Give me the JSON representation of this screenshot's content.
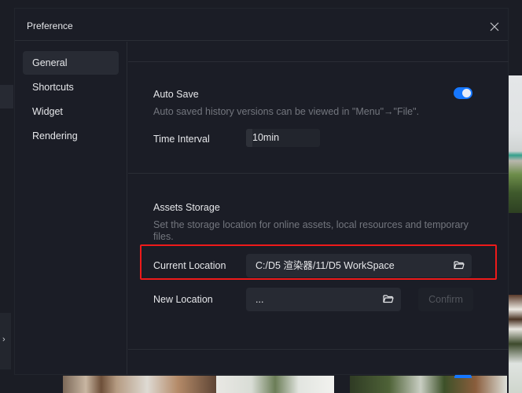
{
  "dialog": {
    "title": "Preference",
    "close_icon": "close-icon"
  },
  "sidebar": {
    "items": [
      {
        "label": "General",
        "active": true
      },
      {
        "label": "Shortcuts",
        "active": false
      },
      {
        "label": "Widget",
        "active": false
      },
      {
        "label": "Rendering",
        "active": false
      }
    ]
  },
  "auto_save": {
    "title": "Auto Save",
    "description": "Auto saved history versions can be viewed in \"Menu\"→\"File\".",
    "enabled": true,
    "time_interval_label": "Time Interval",
    "time_interval_value": "10min"
  },
  "assets_storage": {
    "title": "Assets Storage",
    "description": "Set the storage location for online assets, local resources and temporary files.",
    "current_location_label": "Current Location",
    "current_location_value": "C:/D5 渲染器/11/D5 WorkSpace",
    "new_location_label": "New Location",
    "new_location_value": "...",
    "confirm_label": "Confirm",
    "folder_icon": "folder-open-icon"
  },
  "background": {
    "expand_icon": "chevron-right-icon"
  },
  "colors": {
    "accent": "#1677ff",
    "highlight": "#ee1a1a",
    "panel": "#1b1d26"
  }
}
